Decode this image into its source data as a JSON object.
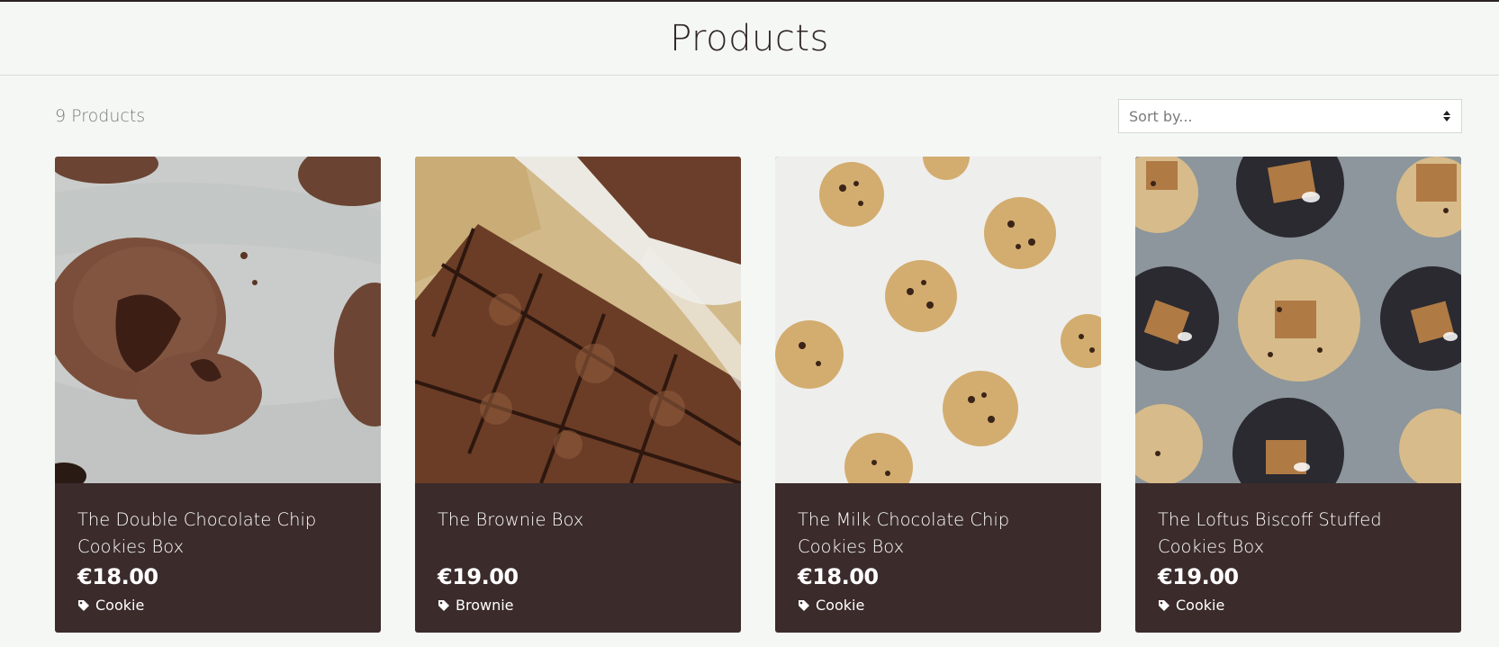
{
  "header": {
    "title": "Products"
  },
  "toolbar": {
    "count_label": "9 Products",
    "sort_placeholder": "Sort by..."
  },
  "products": [
    {
      "name": "The Double Chocolate Chip Cookies Box",
      "price": "€18.00",
      "category": "Cookie",
      "image": "double-chocolate-cookies-photo"
    },
    {
      "name": "The Brownie Box",
      "price": "€19.00",
      "category": "Brownie",
      "image": "brownies-photo"
    },
    {
      "name": "The Milk Chocolate Chip Cookies Box",
      "price": "€18.00",
      "category": "Cookie",
      "image": "milk-chocolate-chip-cookies-photo"
    },
    {
      "name": "The Loftus Biscoff Stuffed Cookies Box",
      "price": "€19.00",
      "category": "Cookie",
      "image": "biscoff-stuffed-cookies-photo"
    }
  ],
  "colors": {
    "card_background": "#3b2b2b",
    "page_background": "#f5f7f5",
    "top_rule": "#2a2224"
  },
  "icons": {
    "tag": "tag-icon",
    "sort": "sort-arrows-icon"
  }
}
